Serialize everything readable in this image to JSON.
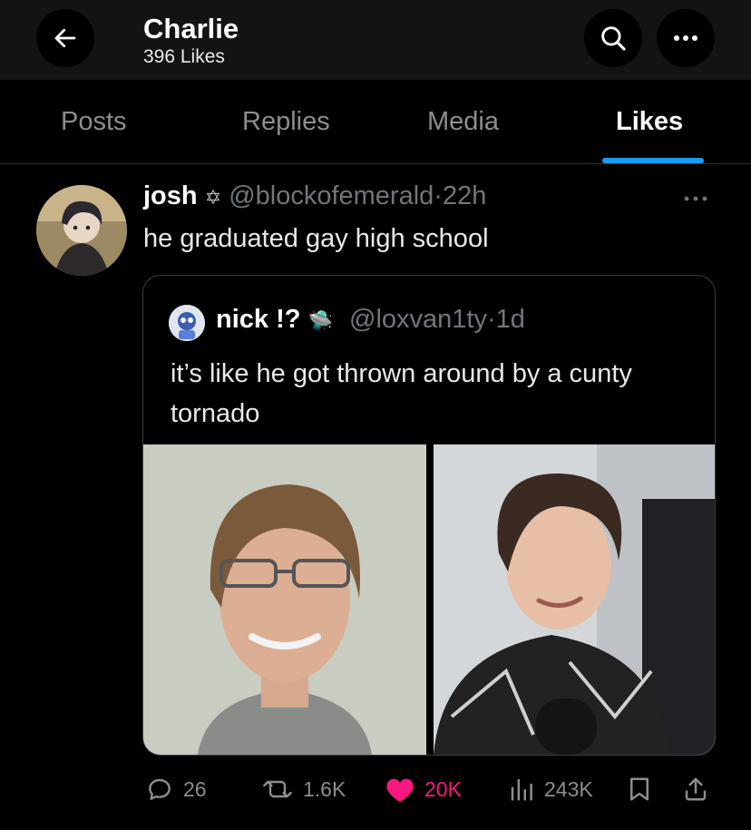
{
  "header": {
    "title": "Charlie",
    "subtitle": "396 Likes"
  },
  "tabs": [
    {
      "label": "Posts"
    },
    {
      "label": "Replies"
    },
    {
      "label": "Media"
    },
    {
      "label": "Likes",
      "active": true
    }
  ],
  "post": {
    "author_name": "josh",
    "author_badge": "✡",
    "handle": "@blockofemerald",
    "separator": "·",
    "time": "22h",
    "text": "he graduated gay high school",
    "quote": {
      "author_name": "nick !?",
      "author_emoji": "🛸",
      "handle": "@loxvan1ty",
      "separator": "·",
      "time": "1d",
      "text": "it’s like he got thrown around by a cunty tornado"
    },
    "stats": {
      "replies": "26",
      "reposts": "1.6K",
      "likes": "20K",
      "views": "243K"
    }
  },
  "colors": {
    "accent": "#1d9bf0",
    "like": "#f91880",
    "muted": "#71767b"
  }
}
